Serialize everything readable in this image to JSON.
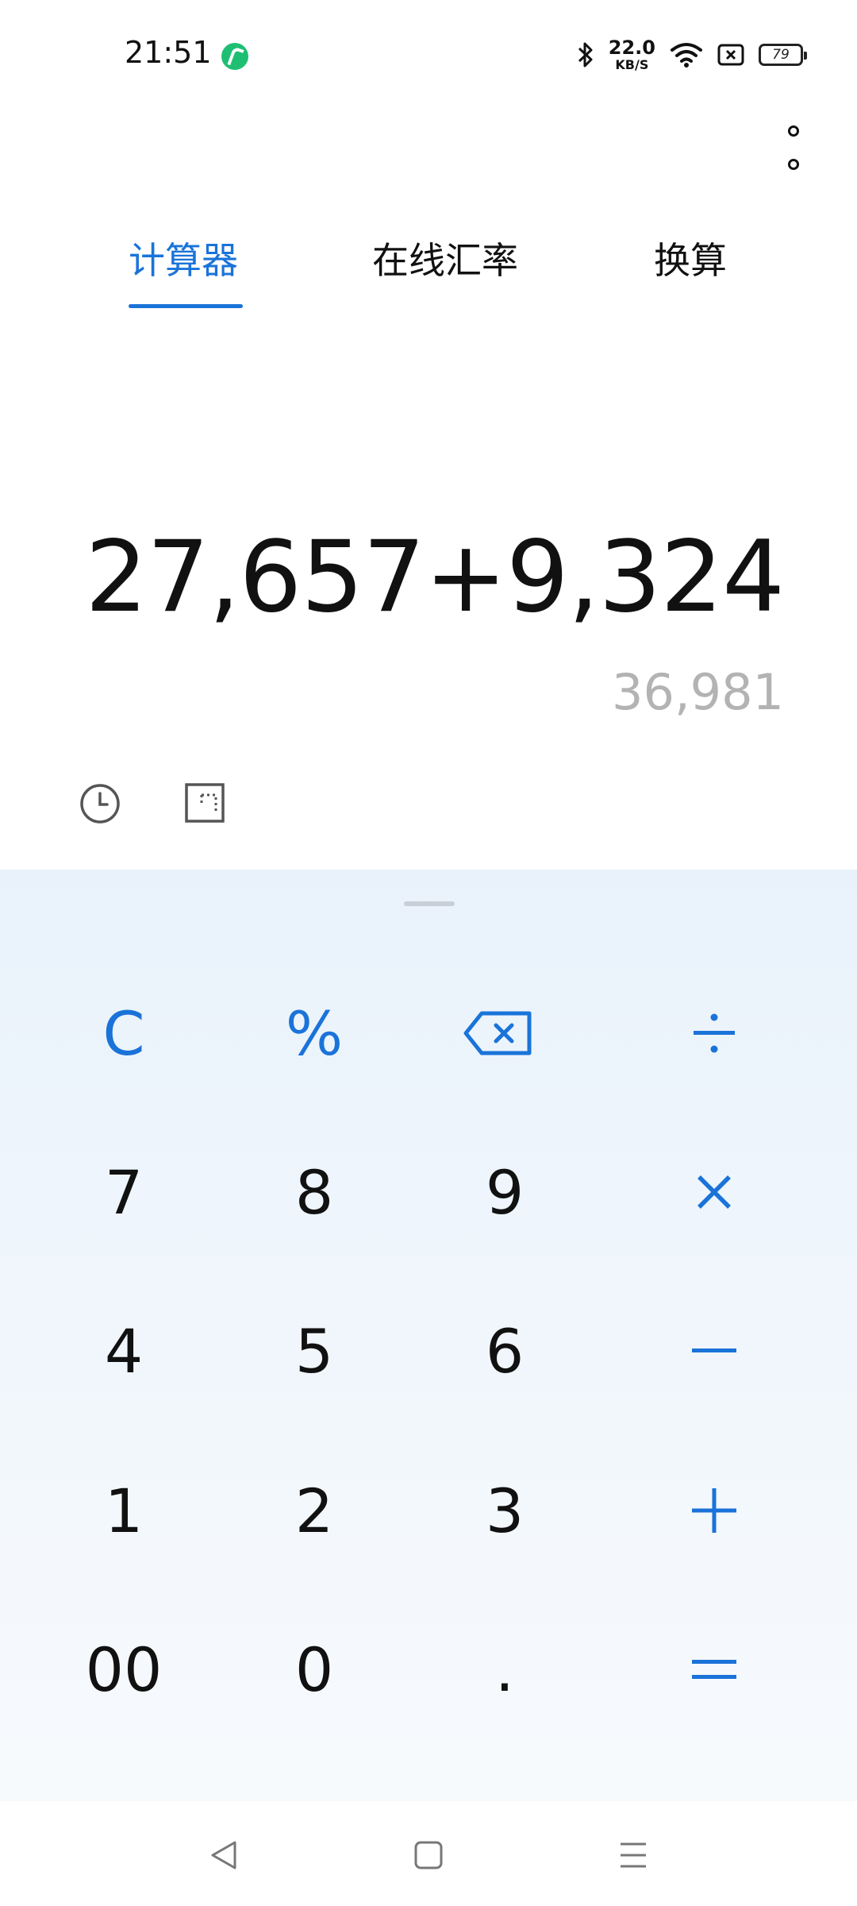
{
  "status_bar": {
    "time": "21:51",
    "net_speed_value": "22.0",
    "net_speed_unit": "KB/S",
    "battery": "79"
  },
  "tabs": [
    {
      "label": "计算器",
      "active": true
    },
    {
      "label": "在线汇率",
      "active": false
    },
    {
      "label": "换算",
      "active": false
    }
  ],
  "display": {
    "expression": "27,657+9,324",
    "result": "36,981"
  },
  "keypad": {
    "row1": [
      "C",
      "%",
      "backspace",
      "÷"
    ],
    "row2": [
      "7",
      "8",
      "9",
      "×"
    ],
    "row3": [
      "4",
      "5",
      "6",
      "−"
    ],
    "row4": [
      "1",
      "2",
      "3",
      "+"
    ],
    "row5": [
      "00",
      "0",
      ".",
      "="
    ]
  },
  "colors": {
    "accent": "#1a73d9",
    "result_gray": "#b3b3b3",
    "keypad_bg": "#eef5fb"
  }
}
